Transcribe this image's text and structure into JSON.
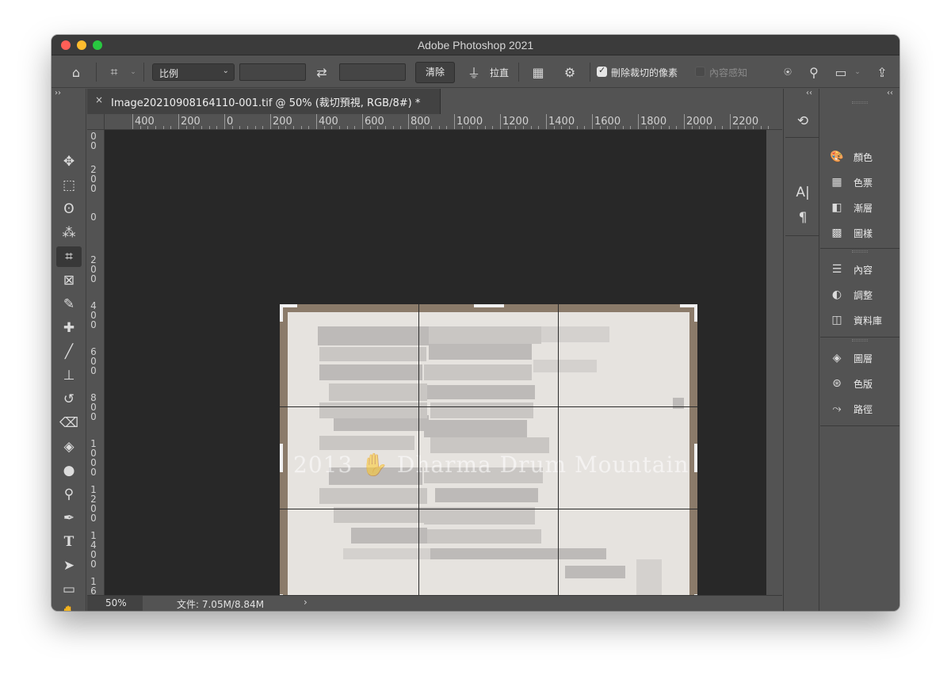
{
  "window": {
    "title": "Adobe Photoshop 2021"
  },
  "options_bar": {
    "ratio_dropdown": "比例",
    "width_value": "",
    "height_value": "",
    "clear_button": "清除",
    "straighten_label": "拉直",
    "delete_cropped_label": "刪除裁切的像素",
    "delete_cropped_checked": true,
    "content_aware_label": "內容感知",
    "content_aware_checked": false
  },
  "document_tab": {
    "close": "×",
    "title": "Image20210908164110-001.tif @ 50% (裁切預視, RGB/8#) *"
  },
  "ruler": {
    "top_labels": [
      "400",
      "200",
      "0",
      "200",
      "400",
      "600",
      "800",
      "1000",
      "1200",
      "1400",
      "1600",
      "1800",
      "2000",
      "2200"
    ],
    "left_labels": [
      "0\n0",
      "2\n0\n0",
      "0",
      "2\n0\n0",
      "4\n0\n0",
      "6\n0\n0",
      "8\n0\n0",
      "1\n0\n0\n0",
      "1\n2\n0\n0",
      "1\n4\n0\n0",
      "1\n6"
    ]
  },
  "canvas": {
    "watermark": "2013 ✋ Dharma Drum Mountain"
  },
  "status_bar": {
    "zoom": "50%",
    "doc_info": "文件: 7.05M/8.84M",
    "arrow": "›"
  },
  "tools": [
    {
      "name": "move",
      "icon": "✥"
    },
    {
      "name": "marquee",
      "icon": "⬚"
    },
    {
      "name": "lasso",
      "icon": "ʘ"
    },
    {
      "name": "magic-wand",
      "icon": "⁂"
    },
    {
      "name": "crop",
      "icon": "⌗"
    },
    {
      "name": "frame",
      "icon": "⊠"
    },
    {
      "name": "eyedropper",
      "icon": "✎"
    },
    {
      "name": "healing",
      "icon": "✚"
    },
    {
      "name": "brush",
      "icon": "🖌"
    },
    {
      "name": "clone-stamp",
      "icon": "⊥"
    },
    {
      "name": "history-brush",
      "icon": "↺"
    },
    {
      "name": "eraser",
      "icon": "⌫"
    },
    {
      "name": "paint-bucket",
      "icon": "◈"
    },
    {
      "name": "blur",
      "icon": "💧"
    },
    {
      "name": "dodge",
      "icon": "⚲"
    },
    {
      "name": "pen",
      "icon": "✒"
    },
    {
      "name": "type",
      "icon": "T"
    },
    {
      "name": "path-selection",
      "icon": "➤"
    },
    {
      "name": "rectangle",
      "icon": "▭"
    },
    {
      "name": "hand",
      "icon": "✋"
    },
    {
      "name": "zoom",
      "icon": "⚲"
    }
  ],
  "right_panels": {
    "group1": [
      {
        "label": "顏色",
        "icon": "palette-icon",
        "glyph": "🎨"
      },
      {
        "label": "色票",
        "icon": "swatches-icon",
        "glyph": "▦"
      },
      {
        "label": "漸層",
        "icon": "gradient-icon",
        "glyph": "◧"
      },
      {
        "label": "圖樣",
        "icon": "patterns-icon",
        "glyph": "▩"
      }
    ],
    "group2": [
      {
        "label": "內容",
        "icon": "properties-icon",
        "glyph": "☰"
      },
      {
        "label": "調整",
        "icon": "adjustments-icon",
        "glyph": "◐"
      },
      {
        "label": "資料庫",
        "icon": "libraries-icon",
        "glyph": "◫"
      }
    ],
    "group3": [
      {
        "label": "圖層",
        "icon": "layers-icon",
        "glyph": "◈"
      },
      {
        "label": "色版",
        "icon": "channels-icon",
        "glyph": "⊛"
      },
      {
        "label": "路徑",
        "icon": "paths-icon",
        "glyph": "⤳"
      }
    ]
  },
  "colors": {
    "window_bg": "#535353",
    "canvas_bg": "#282828",
    "document_border": "#8b7b6a",
    "paper": "#e6e3df"
  }
}
